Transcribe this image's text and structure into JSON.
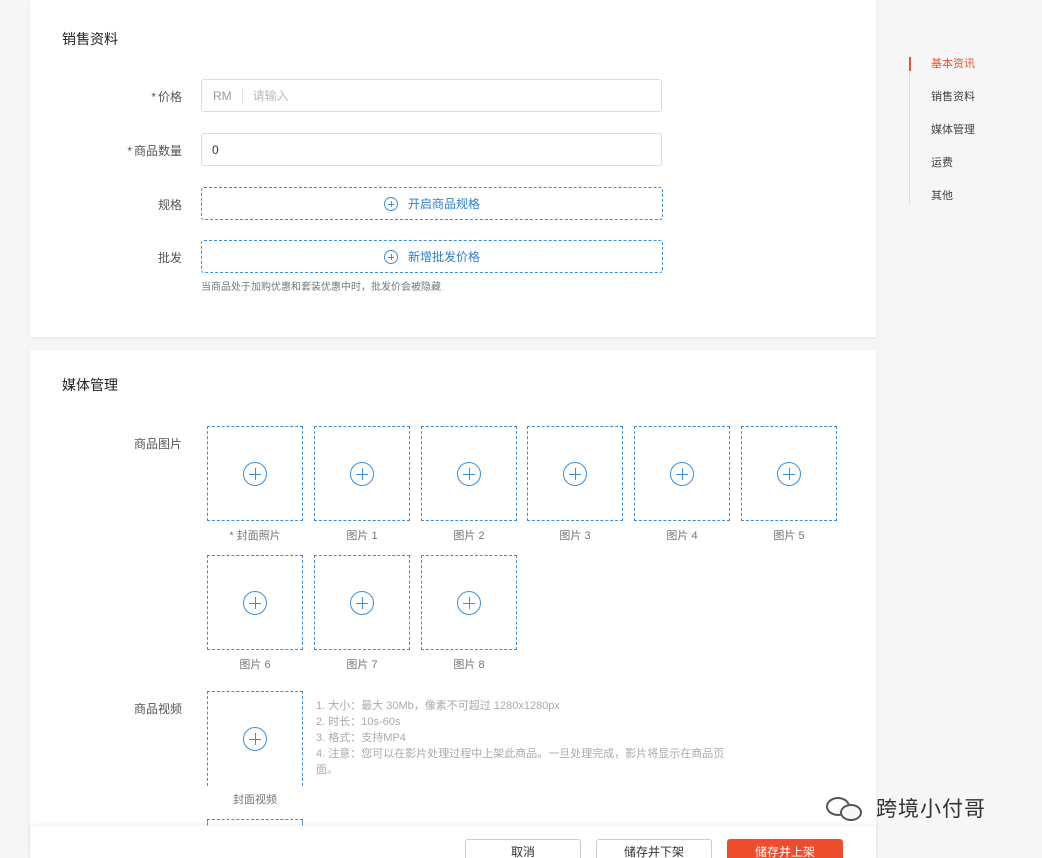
{
  "sales": {
    "title": "销售资料",
    "price": {
      "required_mark": "*",
      "label": "价格",
      "prefix": "RM",
      "placeholder": "请输入"
    },
    "quantity": {
      "required_mark": "*",
      "label": "商品数量",
      "value": "0"
    },
    "spec": {
      "label": "规格",
      "button": "开启商品规格"
    },
    "wholesale": {
      "label": "批发",
      "button": "新增批发价格",
      "hint": "当商品处于加购优惠和套装优惠中时，批发价会被隐藏"
    }
  },
  "media": {
    "title": "媒体管理",
    "images_label": "商品图片",
    "slots": [
      "* 封面照片",
      "图片 1",
      "图片 2",
      "图片 3",
      "图片 4",
      "图片 5",
      "图片 6",
      "图片 7",
      "图片 8"
    ],
    "video_label": "商品视频",
    "video_slot": "封面视频",
    "video_notes": [
      "1. 大小：最大 30Mb，像素不可超过 1280x1280px",
      "2. 时长：10s-60s",
      "3. 格式：支持MP4",
      "4. 注意：您可以在影片处理过程中上架此商品。一旦处理完成，影片将显示在商品页面。"
    ]
  },
  "side_nav": {
    "items": [
      "基本资讯",
      "销售资料",
      "媒体管理",
      "运费",
      "其他"
    ],
    "active_index": 0,
    "accent": "#e8532d"
  },
  "footer": {
    "cancel": "取消",
    "save_delist": "储存并下架",
    "save_publish": "储存并上架",
    "primary_color": "#ee4d2d"
  },
  "watermark": {
    "text": "跨境小付哥"
  }
}
